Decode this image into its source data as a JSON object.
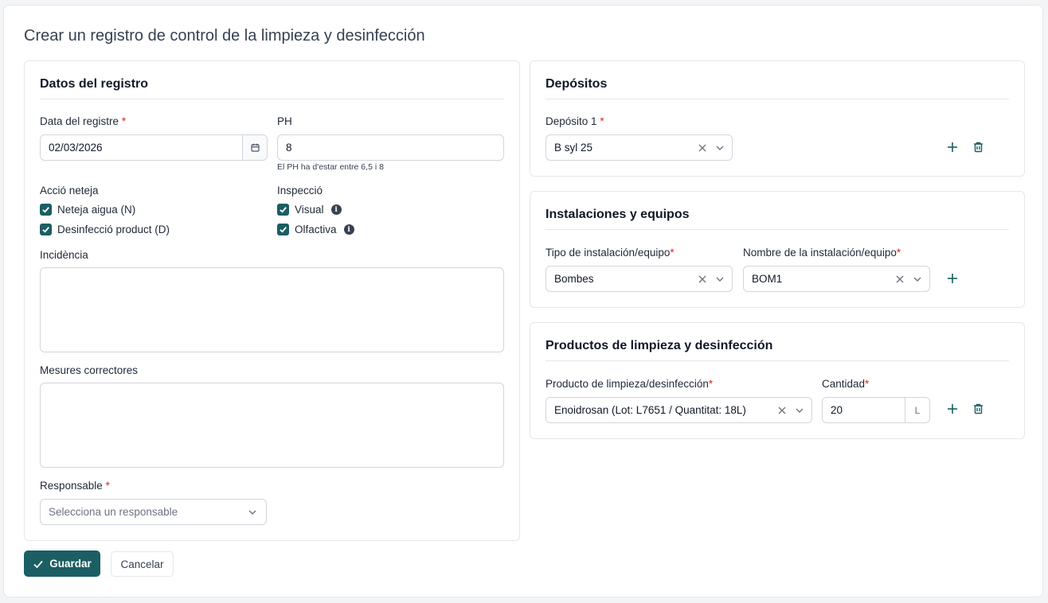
{
  "page": {
    "title": "Crear un registro de control de la limpieza y desinfección"
  },
  "registro": {
    "title": "Datos del registro",
    "date": {
      "label": "Data del registre",
      "required": "*",
      "value": "02/03/2026"
    },
    "ph": {
      "label": "PH",
      "value": "8",
      "hint": "El PH ha d'estar entre 6,5 i 8"
    },
    "accio": {
      "label": "Acció neteja",
      "options": [
        "Neteja aigua (N)",
        "Desinfecció product (D)"
      ]
    },
    "inspeccio": {
      "label": "Inspecció",
      "options": [
        "Visual",
        "Olfactiva"
      ]
    },
    "incidencia": {
      "label": "Incidència",
      "value": ""
    },
    "mesures": {
      "label": "Mesures correctores",
      "value": ""
    },
    "responsable": {
      "label": "Responsable",
      "required": "*",
      "placeholder": "Selecciona un responsable"
    }
  },
  "depositos": {
    "title": "Depósitos",
    "field": {
      "label": "Depósito 1",
      "required": "*",
      "value": "B syl 25"
    }
  },
  "instalaciones": {
    "title": "Instalaciones y equipos",
    "tipo": {
      "label": "Tipo de instalación/equipo",
      "required": "*",
      "value": "Bombes"
    },
    "nombre": {
      "label": "Nombre de la instalación/equipo",
      "required": "*",
      "value": "BOM1"
    }
  },
  "productos": {
    "title": "Productos de limpieza y desinfección",
    "producto": {
      "label": "Producto de limpieza/desinfección",
      "required": "*",
      "value": "Enoidrosan (Lot: L7651 / Quantitat: 18L)"
    },
    "cantidad": {
      "label": "Cantidad",
      "required": "*",
      "value": "20",
      "unit": "L"
    }
  },
  "actions": {
    "save": "Guardar",
    "cancel": "Cancelar"
  },
  "colors": {
    "accent": "#1b5e63",
    "required": "#dc2626",
    "border": "#d1d5db"
  },
  "icons": [
    "calendar-icon",
    "check-icon",
    "info-icon",
    "clear-icon",
    "chevron-down-icon",
    "plus-icon",
    "trash-icon"
  ]
}
